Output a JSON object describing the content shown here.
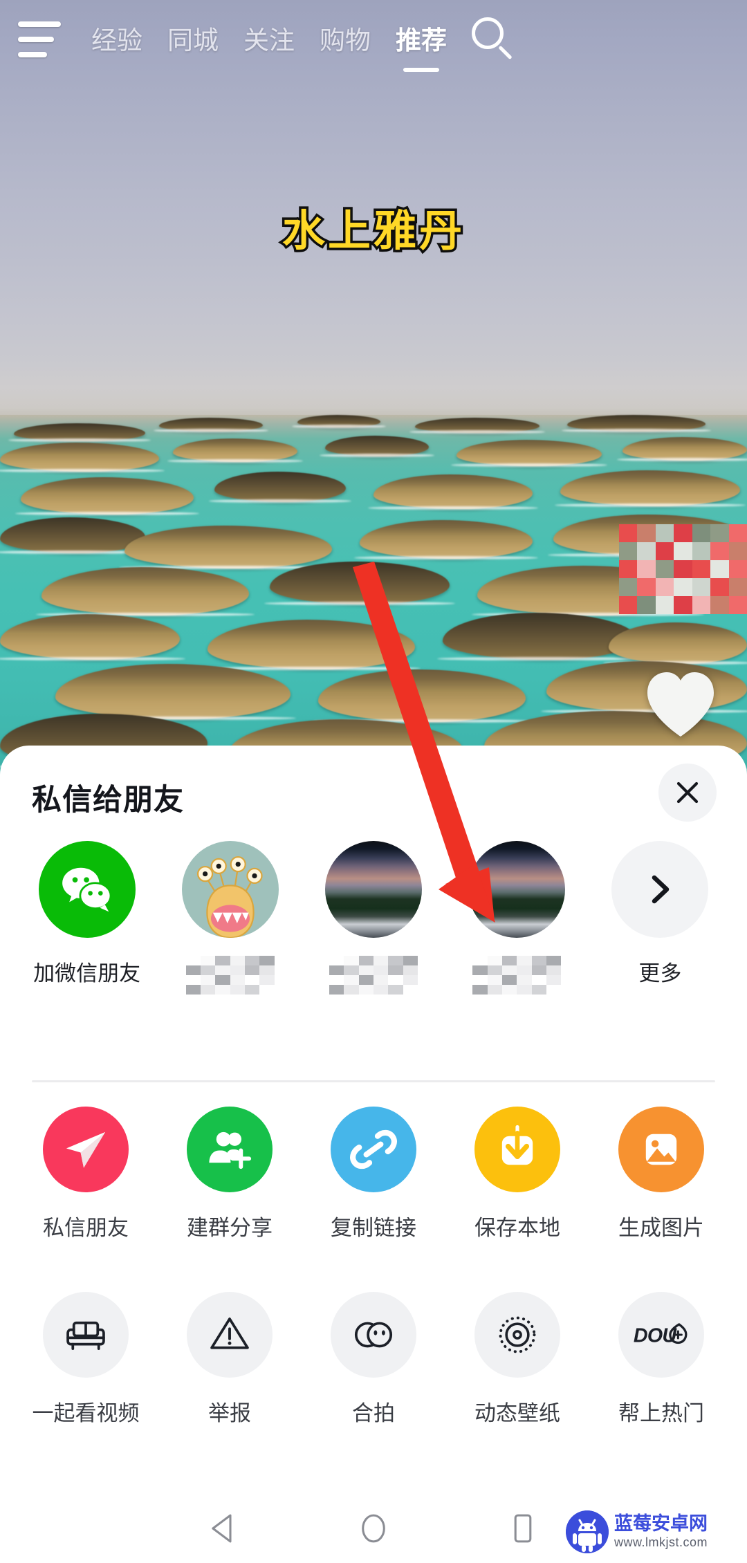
{
  "topnav": {
    "menu_icon": "hamburger-menu-icon",
    "tabs": [
      {
        "label": "经验",
        "active": false
      },
      {
        "label": "同城",
        "active": false
      },
      {
        "label": "关注",
        "active": false
      },
      {
        "label": "购物",
        "active": false
      },
      {
        "label": "推荐",
        "active": true
      }
    ],
    "search_icon": "search-icon"
  },
  "video": {
    "title": "水上雅丹",
    "like_icon": "heart-icon",
    "redacted_overlay": "mosaic-block"
  },
  "sheet": {
    "title": "私信给朋友",
    "close_icon": "close-icon",
    "contacts": [
      {
        "name": "加微信朋友",
        "avatar": "wechat-logo",
        "redacted": false
      },
      {
        "name": "",
        "avatar": "monster-avatar",
        "redacted": true
      },
      {
        "name": "",
        "avatar": "photo-avatar",
        "redacted": true
      },
      {
        "name": "",
        "avatar": "photo-avatar",
        "redacted": true
      },
      {
        "name": "更多",
        "avatar": "chevron-right-icon",
        "redacted": false
      }
    ],
    "actions_row1": [
      {
        "label": "私信朋友",
        "icon": "paper-plane-icon",
        "color": "#F9385C"
      },
      {
        "label": "建群分享",
        "icon": "add-group-icon",
        "color": "#17C04A"
      },
      {
        "label": "复制链接",
        "icon": "link-icon",
        "color": "#46B6EA"
      },
      {
        "label": "保存本地",
        "icon": "download-icon",
        "color": "#FCC00D"
      },
      {
        "label": "生成图片",
        "icon": "image-icon",
        "color": "#F79230"
      }
    ],
    "actions_row2": [
      {
        "label": "一起看视频",
        "icon": "sofa-icon",
        "color": "#F0F1F3"
      },
      {
        "label": "举报",
        "icon": "warning-icon",
        "color": "#F0F1F3"
      },
      {
        "label": "合拍",
        "icon": "duet-icon",
        "color": "#F0F1F3"
      },
      {
        "label": "动态壁纸",
        "icon": "wallpaper-icon",
        "color": "#F0F1F3"
      },
      {
        "label": "帮上热门",
        "icon": "dou-plus-icon",
        "color": "#F0F1F3"
      }
    ]
  },
  "sysnav": {
    "back_icon": "triangle-back-icon",
    "home_icon": "circle-home-icon",
    "recents_icon": "square-recents-icon"
  },
  "watermark": {
    "name": "蓝莓安卓网",
    "url": "www.lmkjst.com",
    "logo_icon": "android-robot-icon"
  },
  "annotation": {
    "arrow_color": "#EE3124",
    "arrow_icon": "red-pointer-arrow"
  },
  "colors": {
    "accent_red": "#F9385C",
    "wechat_green": "#09BB07",
    "sheet_bg": "#FFFFFF",
    "grey_chip": "#F0F1F3",
    "brand_blue": "#3B4DDB"
  }
}
